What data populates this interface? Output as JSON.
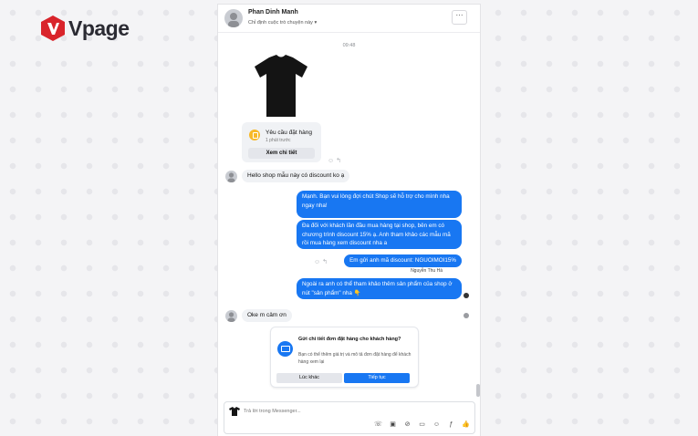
{
  "brand": {
    "name": "Vpage",
    "accent": "#d9242b"
  },
  "header": {
    "contact_name": "Phan Dinh Manh",
    "subtitle": "Chỉ định cuộc trò chuyện này ▾",
    "more_label": "···"
  },
  "chat": {
    "timestamp": "09:48",
    "order_card": {
      "title": "Yêu cầu đặt hàng",
      "time": "1 phút trước",
      "button": "Xem chi tiết"
    },
    "messages": [
      {
        "from": "customer",
        "text": "Hello shop mẫu này có discount ko ạ"
      },
      {
        "from": "shop",
        "text": "Mạnh. Bạn vui lòng đợi chút Shop sẽ hỗ trợ cho mình nha ngay nha!"
      },
      {
        "from": "shop",
        "text": "Đa đối với khách lần đầu mua hàng tại shop, bên em có chương trình discount 15% ạ. Anh tham khảo các mẫu mã rồi mua hàng xem discount nha a"
      },
      {
        "from": "shop",
        "text": "Em gửi anh mã discount: NGUOIMOI15%"
      },
      {
        "from": "shop",
        "text": "Ngoài ra anh có thể tham khảo thêm sản phẩm của shop ở nút \"sản phẩm\" nha 👇"
      },
      {
        "from": "customer",
        "text": "Oke m cảm ơn"
      }
    ],
    "seen_by": "Nguyễn Thu Hà",
    "reaction_icons": "☺ ↰"
  },
  "prompt": {
    "title": "Gửi chi tiết đơn đặt hàng cho khách hàng?",
    "description": "Bạn có thể thêm giá trị và mô tả đơn đặt hàng để khách hàng xem lại",
    "later_button": "Lúc khác",
    "continue_button": "Tiếp tục"
  },
  "composer": {
    "placeholder": "Trả lời trong Messenger...",
    "tools": [
      "phone-icon",
      "shop-icon",
      "attach-icon",
      "quick-reply-icon",
      "emoji-icon",
      "gif-icon",
      "like-icon"
    ]
  }
}
